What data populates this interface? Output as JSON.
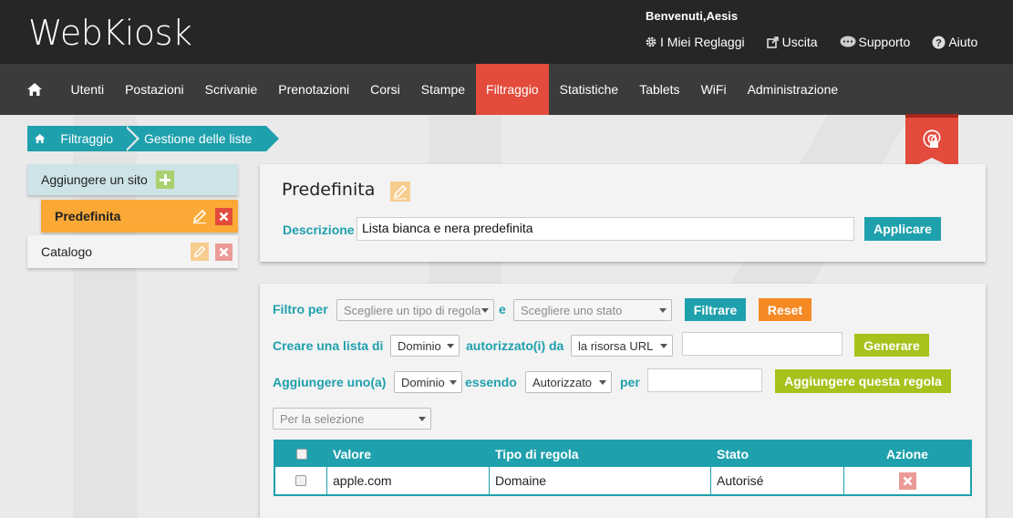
{
  "header": {
    "logo": "WebKiosk",
    "welcome": "Benvenuti,Aesis",
    "links": [
      {
        "label": "I Miei Reglaggi",
        "icon": "gear-icon"
      },
      {
        "label": "Uscita",
        "icon": "external-link-icon"
      },
      {
        "label": "Supporto",
        "icon": "chat-bubble-icon"
      },
      {
        "label": "Aiuto",
        "icon": "question-circle-icon"
      }
    ]
  },
  "nav": {
    "home_icon": "home-icon",
    "items": [
      "Utenti",
      "Postazioni",
      "Scrivanie",
      "Prenotazioni",
      "Corsi",
      "Stampe",
      "Filtraggio",
      "Statistiche",
      "Tablets",
      "WiFi",
      "Administrazione"
    ],
    "active": "Filtraggio",
    "active_color": "#e34b3c"
  },
  "breadcrumb": {
    "items": [
      "Filtraggio",
      "Gestione delle liste"
    ]
  },
  "lists": {
    "add_label": "Aggiungere un sito",
    "items": [
      {
        "name": "Predefinita",
        "selected": true
      },
      {
        "name": "Catalogo",
        "selected": false
      }
    ]
  },
  "list_detail": {
    "title": "Predefinita",
    "description_label": "Descrizione",
    "description_value": "Lista bianca e nera predefinita",
    "apply_label": "Applicare"
  },
  "filters": {
    "filter_by_label": "Filtro per",
    "rule_type_placeholder": "Scegliere un tipo di regola",
    "and_label": "e",
    "state_placeholder": "Scegliere uno stato",
    "filter_button": "Filtrare",
    "reset_button": "Reset",
    "create_list_label": "Creare una lista di",
    "create_type_value": "Dominio",
    "authorized_by_label": "autorizzato(i) da",
    "resource_value": "la risorsa URL",
    "resource_input": "",
    "generate_button": "Generare",
    "add_one_label": "Aggiungere uno(a)",
    "add_type_value": "Dominio",
    "being_label": "essendo",
    "add_state_value": "Autorizzato",
    "for_label": "per",
    "add_input": "",
    "add_rule_button": "Aggiungere questa regola",
    "selection_placeholder": "Per la selezione"
  },
  "table": {
    "headers": [
      "Valore",
      "Tipo di regola",
      "Stato",
      "Azione"
    ],
    "rows": [
      {
        "value": "apple.com",
        "type": "Domaine",
        "state": "Autorisé"
      }
    ]
  },
  "colors": {
    "teal": "#1fa0ad",
    "orange": "#f58a24",
    "green": "#a6c21c",
    "red": "#e34b3c",
    "list_selected": "#fba936"
  }
}
